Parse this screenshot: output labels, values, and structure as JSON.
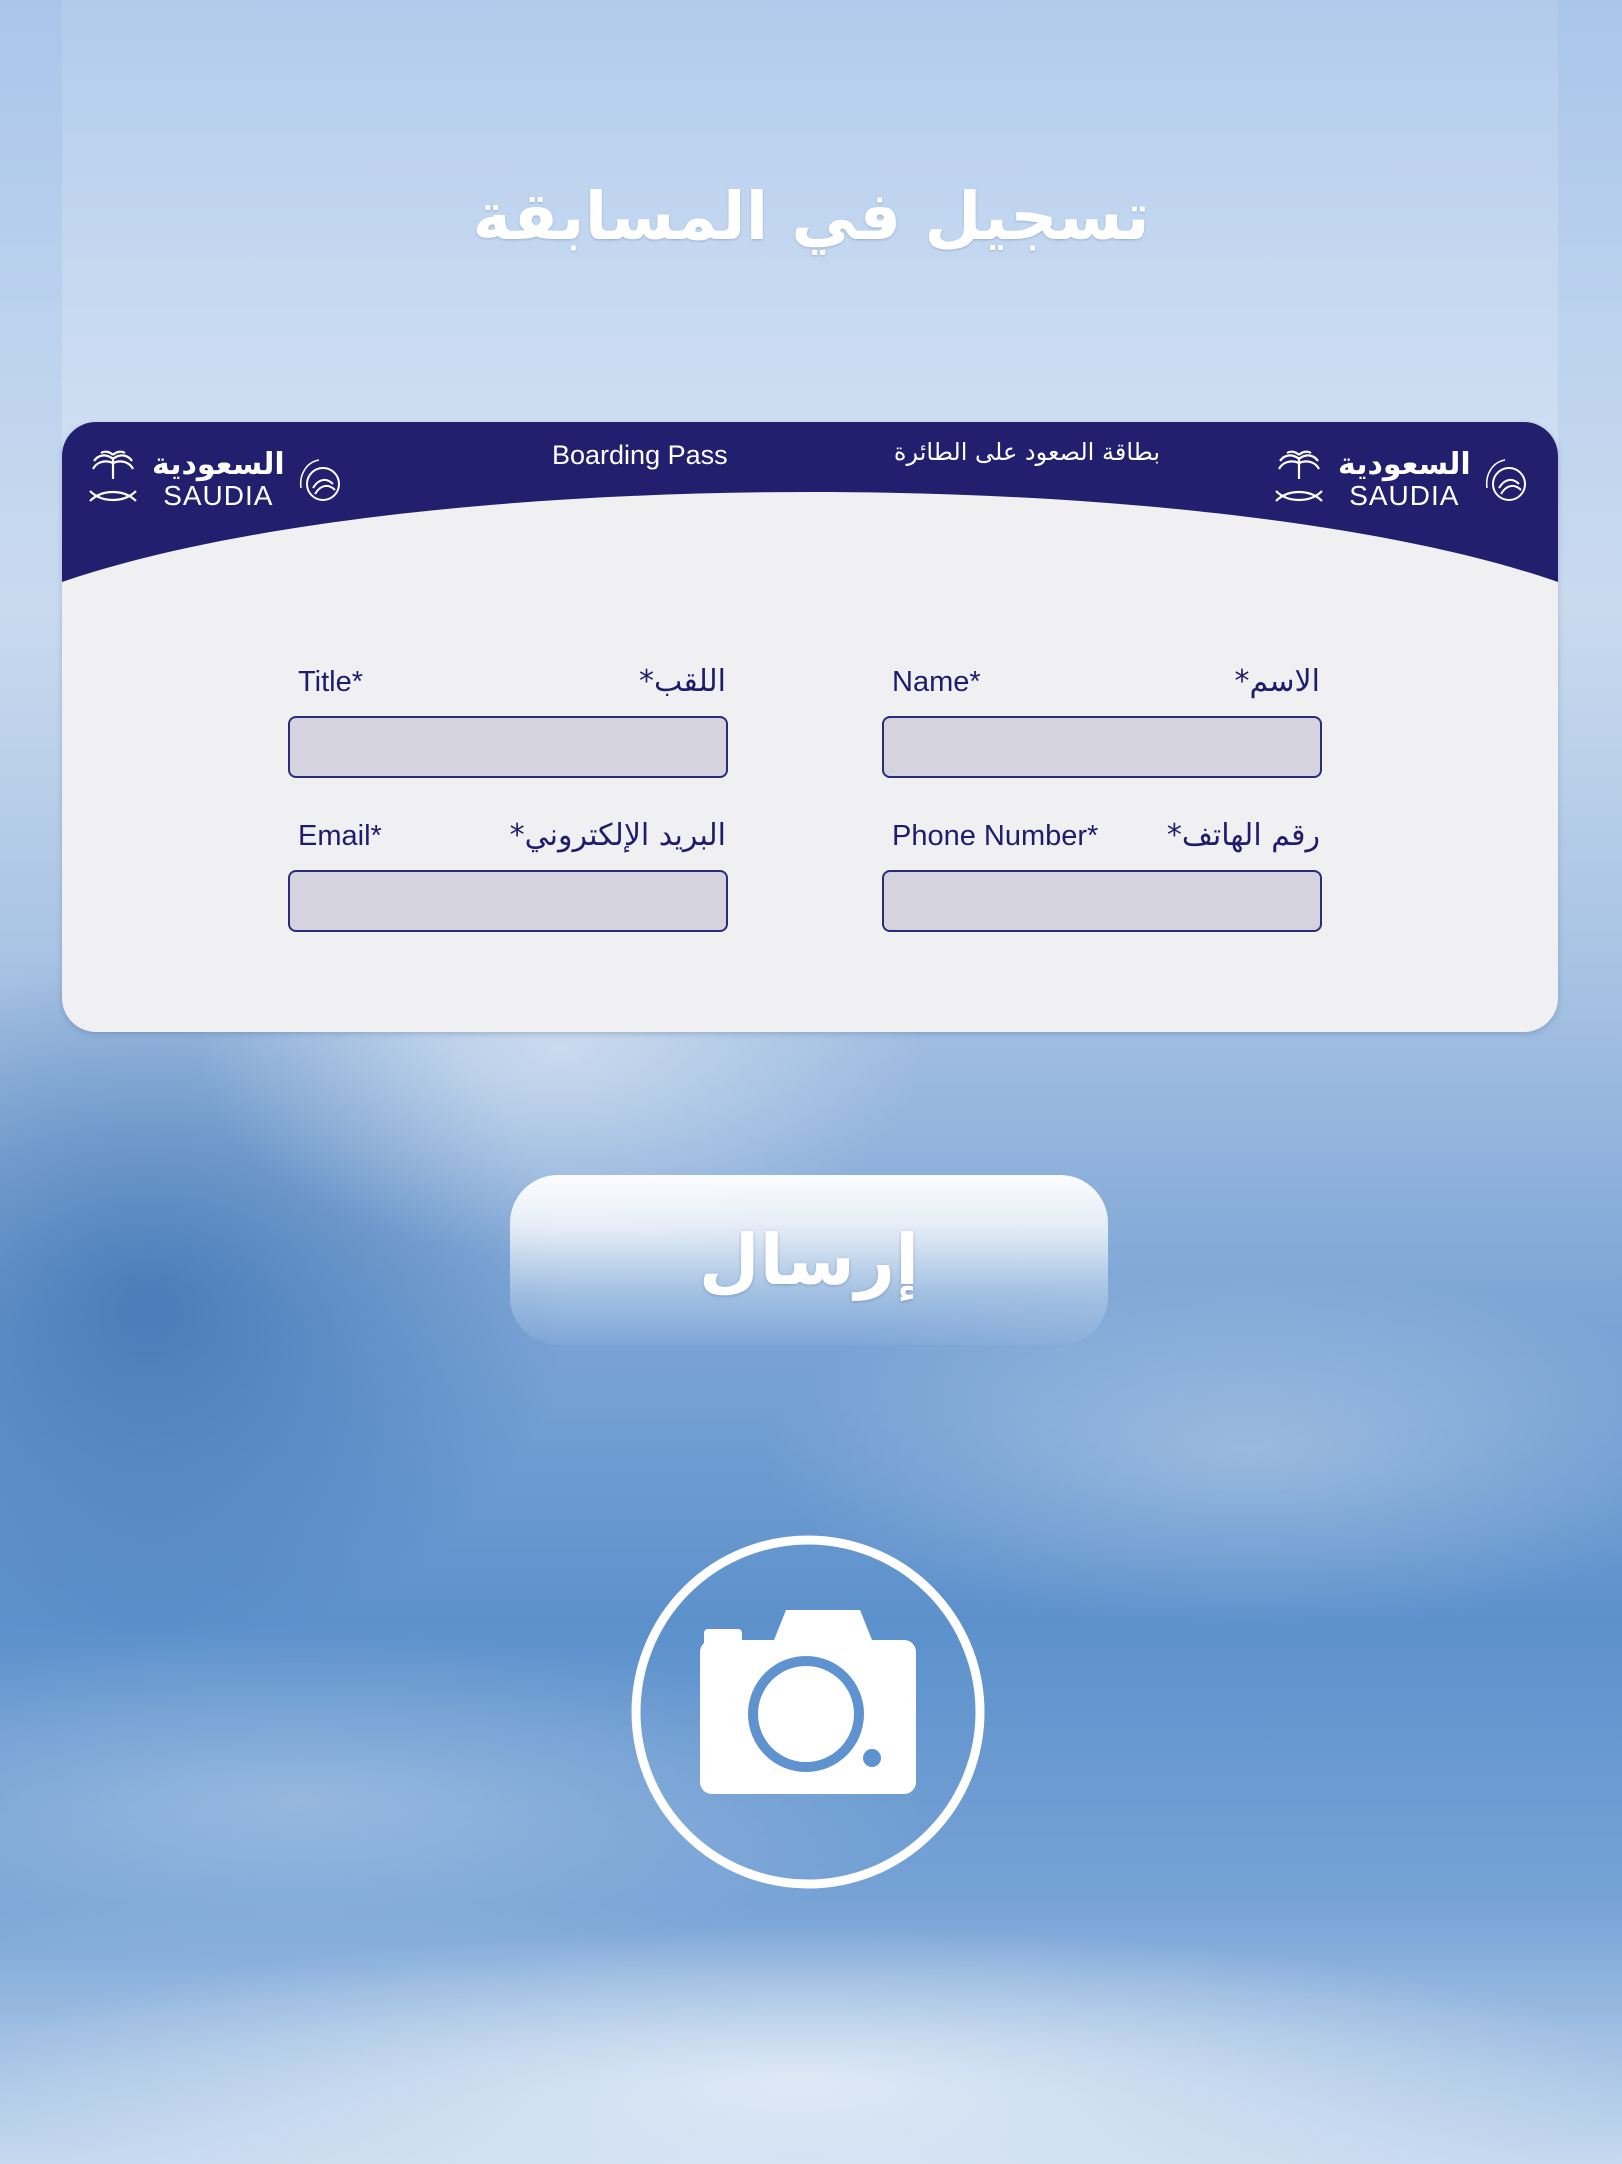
{
  "page": {
    "title": "تسجيل في المسابقة"
  },
  "card": {
    "header_en": "Boarding Pass",
    "header_ar": "بطاقة الصعود على الطائرة",
    "brand_ar": "السعودية",
    "brand_en": "SAUDIA",
    "header_color": "#22206e"
  },
  "form": {
    "title": {
      "label_en": "Title*",
      "label_ar": "اللقب*",
      "value": ""
    },
    "name": {
      "label_en": "Name*",
      "label_ar": "الاسم*",
      "value": ""
    },
    "email": {
      "label_en": "Email*",
      "label_ar": "البريد الإلكتروني*",
      "value": ""
    },
    "phone": {
      "label_en": "Phone Number*",
      "label_ar": "رقم الهاتف*",
      "value": ""
    }
  },
  "submit": {
    "label": "إرسال"
  },
  "icons": {
    "camera": "camera-icon",
    "palm": "palm-swords-icon",
    "skyteam": "skyteam-icon"
  }
}
